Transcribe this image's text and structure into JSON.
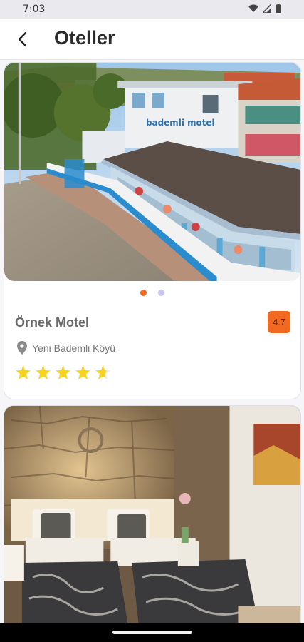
{
  "status_bar": {
    "time": "7:03"
  },
  "header": {
    "title": "Oteller"
  },
  "hotels": [
    {
      "name": "Örnek Motel",
      "rating": "4.7",
      "location": "Yeni Bademli Köyü",
      "stars": 4.5,
      "signage": "bademli motel",
      "carousel": {
        "active_index": 0,
        "count": 2
      }
    }
  ],
  "colors": {
    "accent": "#f26a21",
    "star": "#f7d21e",
    "dot_inactive": "#c9c6ef"
  },
  "icons": [
    "back-arrow-icon",
    "location-pin-icon",
    "star-icon",
    "wifi-icon",
    "signal-icon",
    "battery-icon"
  ]
}
